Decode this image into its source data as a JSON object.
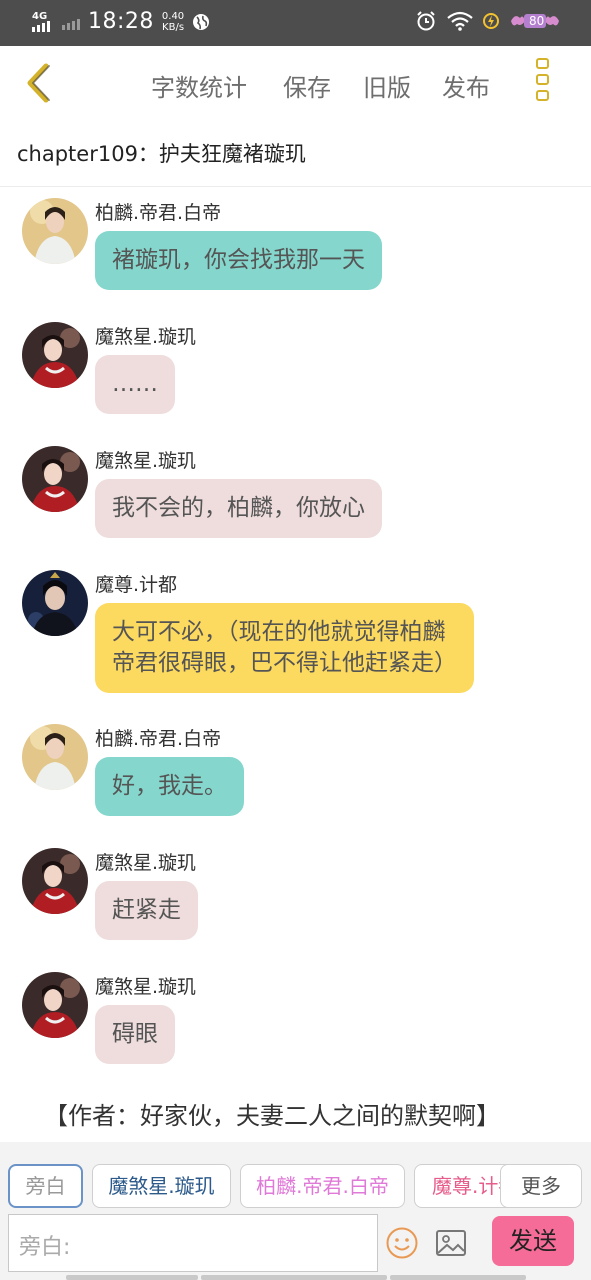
{
  "status_bar": {
    "network": "4G",
    "time": "18:28",
    "speed_value": "0.40",
    "speed_unit": "KB/s",
    "battery": "80"
  },
  "header": {
    "menu": [
      "字数统计",
      "保存",
      "旧版",
      "发布"
    ]
  },
  "chapter_title": "chapter109：护夫狂魔褚璇玑",
  "messages": [
    {
      "name": "柏麟.帝君.白帝",
      "text": "褚璇玑，你会找我那一天",
      "style": "teal",
      "avatar": "bailin-avatar"
    },
    {
      "name": "魔煞星.璇玑",
      "text": "……",
      "style": "pink",
      "avatar": "xuanji-avatar"
    },
    {
      "name": "魔煞星.璇玑",
      "text": "我不会的，柏麟，你放心",
      "style": "pink",
      "avatar": "xuanji-avatar"
    },
    {
      "name": "魔尊.计都",
      "text_lines": [
        "大可不必，（现在的他就觉得柏麟",
        "帝君很碍眼，巴不得让他赶紧走）"
      ],
      "style": "yellow",
      "avatar": "jidu-avatar"
    },
    {
      "name": "柏麟.帝君.白帝",
      "text": "好，我走。",
      "style": "teal",
      "avatar": "bailin-avatar"
    },
    {
      "name": "魔煞星.璇玑",
      "text": "赶紧走",
      "style": "pink",
      "avatar": "xuanji-avatar"
    },
    {
      "name": "魔煞星.璇玑",
      "text": "碍眼",
      "style": "pink",
      "avatar": "xuanji-avatar"
    }
  ],
  "narration": "【作者：好家伙，夫妻二人之间的默契啊】",
  "role_chips": [
    {
      "label": "旁白",
      "color": "#999999",
      "selected": true
    },
    {
      "label": "魔煞星.璇玑",
      "color": "#2c5a8a",
      "selected": false
    },
    {
      "label": "柏麟.帝君.白帝",
      "color": "#e07ad8",
      "selected": false
    },
    {
      "label": "魔尊.计都",
      "color": "#e65c8a",
      "selected": false
    }
  ],
  "more_label": "更多",
  "input": {
    "placeholder": "旁白:"
  },
  "send_label": "发送",
  "colors": {
    "teal_bubble": "#85d7cd",
    "pink_bubble": "#efdddd",
    "yellow_bubble": "#fcd95f",
    "accent_yellow": "#d4b22a",
    "send_button": "#f56c98"
  }
}
